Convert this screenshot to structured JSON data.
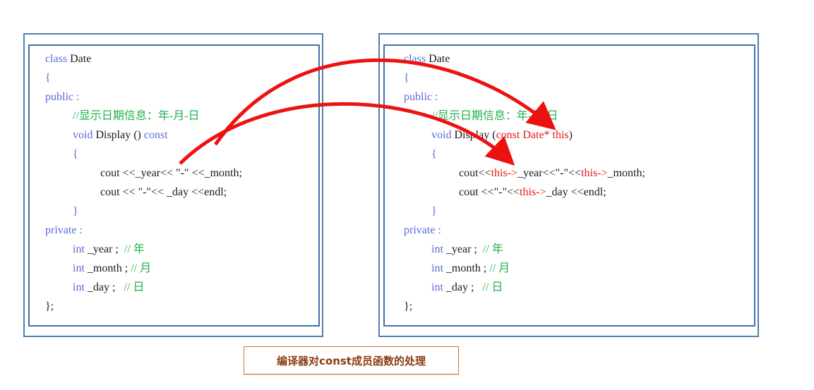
{
  "left_panel": {
    "lines": [
      {
        "indent": 0,
        "segments": [
          {
            "t": "class",
            "c": "kw"
          },
          {
            "t": " Date",
            "c": ""
          }
        ]
      },
      {
        "indent": 0,
        "segments": [
          {
            "t": "{",
            "c": "kw"
          }
        ]
      },
      {
        "indent": 0,
        "segments": [
          {
            "t": "public",
            "c": "kw"
          },
          {
            "t": " :",
            "c": "kw"
          }
        ]
      },
      {
        "indent": 1,
        "segments": [
          {
            "t": "//显示日期信息：年-月-日",
            "c": "cm"
          }
        ]
      },
      {
        "indent": 1,
        "segments": [
          {
            "t": "void",
            "c": "kw"
          },
          {
            "t": " Display () ",
            "c": ""
          },
          {
            "t": "const",
            "c": "kw"
          }
        ]
      },
      {
        "indent": 1,
        "segments": [
          {
            "t": "{",
            "c": "kw"
          }
        ]
      },
      {
        "indent": 2,
        "segments": [
          {
            "t": "cout <<_year<< \"-\" <<_month;",
            "c": ""
          }
        ]
      },
      {
        "indent": 2,
        "segments": [
          {
            "t": "cout << \"-\"<< _day <<endl;",
            "c": ""
          }
        ]
      },
      {
        "indent": 1,
        "segments": [
          {
            "t": "}",
            "c": "kw"
          }
        ]
      },
      {
        "indent": 0,
        "segments": [
          {
            "t": "private",
            "c": "kw"
          },
          {
            "t": " :",
            "c": "kw"
          }
        ]
      },
      {
        "indent": 1,
        "segments": [
          {
            "t": "int",
            "c": "kw"
          },
          {
            "t": " _year ;  ",
            "c": ""
          },
          {
            "t": "// 年",
            "c": "cm"
          }
        ]
      },
      {
        "indent": 1,
        "segments": [
          {
            "t": "int",
            "c": "kw"
          },
          {
            "t": " _month ; ",
            "c": ""
          },
          {
            "t": "// 月",
            "c": "cm"
          }
        ]
      },
      {
        "indent": 1,
        "segments": [
          {
            "t": "int",
            "c": "kw"
          },
          {
            "t": " _day ;   ",
            "c": ""
          },
          {
            "t": "// 日",
            "c": "cm"
          }
        ]
      },
      {
        "indent": 0,
        "segments": [
          {
            "t": "};",
            "c": ""
          }
        ]
      }
    ]
  },
  "right_panel": {
    "lines": [
      {
        "indent": 0,
        "segments": [
          {
            "t": "class",
            "c": "kw"
          },
          {
            "t": " Date",
            "c": ""
          }
        ]
      },
      {
        "indent": 0,
        "segments": [
          {
            "t": "{",
            "c": "kw"
          }
        ]
      },
      {
        "indent": 0,
        "segments": [
          {
            "t": "public",
            "c": "kw"
          },
          {
            "t": " :",
            "c": "kw"
          }
        ]
      },
      {
        "indent": 1,
        "segments": [
          {
            "t": "//显示日期信息：年-月-日",
            "c": "cm"
          }
        ]
      },
      {
        "indent": 1,
        "segments": [
          {
            "t": "void",
            "c": "kw"
          },
          {
            "t": " Display (",
            "c": ""
          },
          {
            "t": "const Date* this",
            "c": "red"
          },
          {
            "t": ")",
            "c": ""
          }
        ]
      },
      {
        "indent": 1,
        "segments": [
          {
            "t": "{",
            "c": "kw"
          }
        ]
      },
      {
        "indent": 2,
        "segments": [
          {
            "t": "cout<<",
            "c": ""
          },
          {
            "t": "this->",
            "c": "red"
          },
          {
            "t": "_year<<\"-\"<<",
            "c": ""
          },
          {
            "t": "this->",
            "c": "red"
          },
          {
            "t": "_month;",
            "c": ""
          }
        ]
      },
      {
        "indent": 2,
        "segments": [
          {
            "t": "cout <<\"-\"<<",
            "c": ""
          },
          {
            "t": "this->",
            "c": "red"
          },
          {
            "t": "_day <<endl;",
            "c": ""
          }
        ]
      },
      {
        "indent": 1,
        "segments": [
          {
            "t": "}",
            "c": "kw"
          }
        ]
      },
      {
        "indent": 0,
        "segments": [
          {
            "t": "private",
            "c": "kw"
          },
          {
            "t": " :",
            "c": "kw"
          }
        ]
      },
      {
        "indent": 1,
        "segments": [
          {
            "t": "int",
            "c": "kw"
          },
          {
            "t": " _year ;  ",
            "c": ""
          },
          {
            "t": "// 年",
            "c": "cm"
          }
        ]
      },
      {
        "indent": 1,
        "segments": [
          {
            "t": "int",
            "c": "kw"
          },
          {
            "t": " _month ; ",
            "c": ""
          },
          {
            "t": "// 月",
            "c": "cm"
          }
        ]
      },
      {
        "indent": 1,
        "segments": [
          {
            "t": "int",
            "c": "kw"
          },
          {
            "t": " _day ;   ",
            "c": ""
          },
          {
            "t": "// 日",
            "c": "cm"
          }
        ]
      },
      {
        "indent": 0,
        "segments": [
          {
            "t": "};",
            "c": ""
          }
        ]
      }
    ]
  },
  "arrows": [
    {
      "from": "left const keyword",
      "to": "right const Date* this parameter",
      "color": "#ee1111"
    },
    {
      "from": "left cout statement",
      "to": "right this-> member access",
      "color": "#ee1111"
    }
  ],
  "caption": {
    "text": "编译器对const成员函数的处理"
  },
  "colors": {
    "keyword": "#5b6bd8",
    "comment": "#22b14c",
    "highlight": "#e21b1b",
    "border": "#3f71a6",
    "caption_text": "#8b3a10",
    "caption_border": "#c97a3a"
  }
}
